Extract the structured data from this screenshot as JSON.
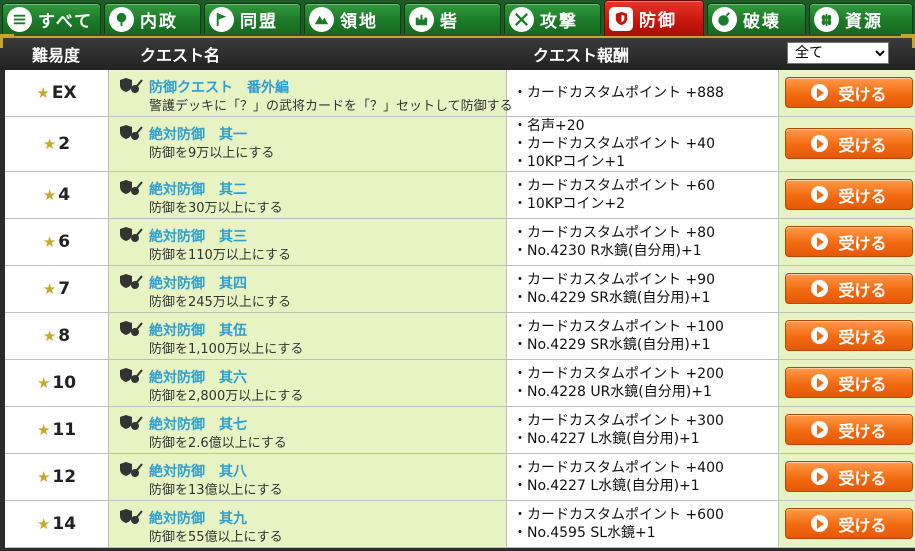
{
  "tabs": [
    {
      "label": "すべて",
      "icon": "list-icon",
      "active": false
    },
    {
      "label": "内政",
      "icon": "tree-icon",
      "active": false
    },
    {
      "label": "同盟",
      "icon": "flag-icon",
      "active": false
    },
    {
      "label": "領地",
      "icon": "territory-icon",
      "active": false
    },
    {
      "label": "砦",
      "icon": "fort-icon",
      "active": false
    },
    {
      "label": "攻撃",
      "icon": "crossed-swords-icon",
      "active": false
    },
    {
      "label": "防御",
      "icon": "shield-icon",
      "active": true
    },
    {
      "label": "破壊",
      "icon": "bomb-icon",
      "active": false
    },
    {
      "label": "資源",
      "icon": "wheat-icon",
      "active": false
    }
  ],
  "header": {
    "difficulty": "難易度",
    "quest_name": "クエスト名",
    "reward": "クエスト報酬",
    "filter_selected": "全て"
  },
  "accept_label": "受ける",
  "colors": {
    "tab_green": "#1d7a2a",
    "tab_active_red": "#c5160d",
    "title_blue": "#2e9fd0",
    "row_green": "#e8f3c4",
    "button_orange": "#f26a10",
    "star_gold": "#c9a62c"
  },
  "quests": [
    {
      "difficulty": "EX",
      "title": "防御クエスト　番外編",
      "desc": "警護デッキに「？」の武将カードを「？」セットして防御する",
      "rewards": [
        "・カードカスタムポイント +888"
      ]
    },
    {
      "difficulty": "2",
      "title": "絶対防御　其一",
      "desc": "防御を9万以上にする",
      "rewards": [
        "・名声+20",
        "・カードカスタムポイント +40",
        "・10KPコイン+1"
      ]
    },
    {
      "difficulty": "4",
      "title": "絶対防御　其二",
      "desc": "防御を30万以上にする",
      "rewards": [
        "・カードカスタムポイント +60",
        "・10KPコイン+2"
      ]
    },
    {
      "difficulty": "6",
      "title": "絶対防御　其三",
      "desc": "防御を110万以上にする",
      "rewards": [
        "・カードカスタムポイント +80",
        "・No.4230 R水鏡(自分用)+1"
      ]
    },
    {
      "difficulty": "7",
      "title": "絶対防御　其四",
      "desc": "防御を245万以上にする",
      "rewards": [
        "・カードカスタムポイント +90",
        "・No.4229 SR水鏡(自分用)+1"
      ]
    },
    {
      "difficulty": "8",
      "title": "絶対防御　其伍",
      "desc": "防御を1,100万以上にする",
      "rewards": [
        "・カードカスタムポイント +100",
        "・No.4229 SR水鏡(自分用)+1"
      ]
    },
    {
      "difficulty": "10",
      "title": "絶対防御　其六",
      "desc": "防御を2,800万以上にする",
      "rewards": [
        "・カードカスタムポイント +200",
        "・No.4228 UR水鏡(自分用)+1"
      ]
    },
    {
      "difficulty": "11",
      "title": "絶対防御　其七",
      "desc": "防御を2.6億以上にする",
      "rewards": [
        "・カードカスタムポイント +300",
        "・No.4227 L水鏡(自分用)+1"
      ]
    },
    {
      "difficulty": "12",
      "title": "絶対防御　其八",
      "desc": "防御を13億以上にする",
      "rewards": [
        "・カードカスタムポイント +400",
        "・No.4227 L水鏡(自分用)+1"
      ]
    },
    {
      "difficulty": "14",
      "title": "絶対防御　其九",
      "desc": "防御を55億以上にする",
      "rewards": [
        "・カードカスタムポイント +600",
        "・No.4595 SL水鏡+1"
      ]
    }
  ]
}
